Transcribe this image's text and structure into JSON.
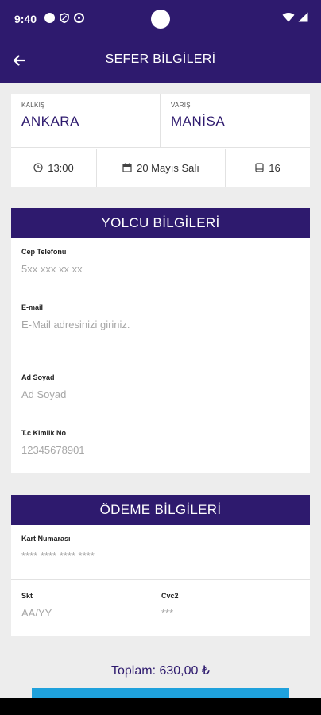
{
  "status_bar": {
    "time": "9:40"
  },
  "app_bar": {
    "title": "SEFER BİLGİLERİ"
  },
  "trip": {
    "from_label": "KALKIŞ",
    "from_value": "ANKARA",
    "to_label": "VARIŞ",
    "to_value": "MANİSA",
    "time": "13:00",
    "date": "20 Mayıs Salı",
    "seat": "16"
  },
  "passenger": {
    "header": "YOLCU BİLGİLERİ",
    "phone_label": "Cep Telefonu",
    "phone_placeholder": "5xx xxx xx xx",
    "email_label": "E-mail",
    "email_placeholder": "E-Mail adresinizi giriniz.",
    "name_label": "Ad Soyad",
    "name_placeholder": "Ad Soyad",
    "tc_label": "T.c Kimlik No",
    "tc_placeholder": "12345678901"
  },
  "payment": {
    "header": "ÖDEME BİLGİLERİ",
    "card_label": "Kart Numarası",
    "card_placeholder": "**** **** **** ****",
    "expiry_label": "Skt",
    "expiry_placeholder": "AA/YY",
    "cvc_label": "Cvc2",
    "cvc_placeholder": "***"
  },
  "summary": {
    "total": "Toplam: 630,00 ₺"
  },
  "colors": {
    "primary": "#2e1a6e",
    "accent": "#1fa1dc",
    "background": "#ededed"
  }
}
